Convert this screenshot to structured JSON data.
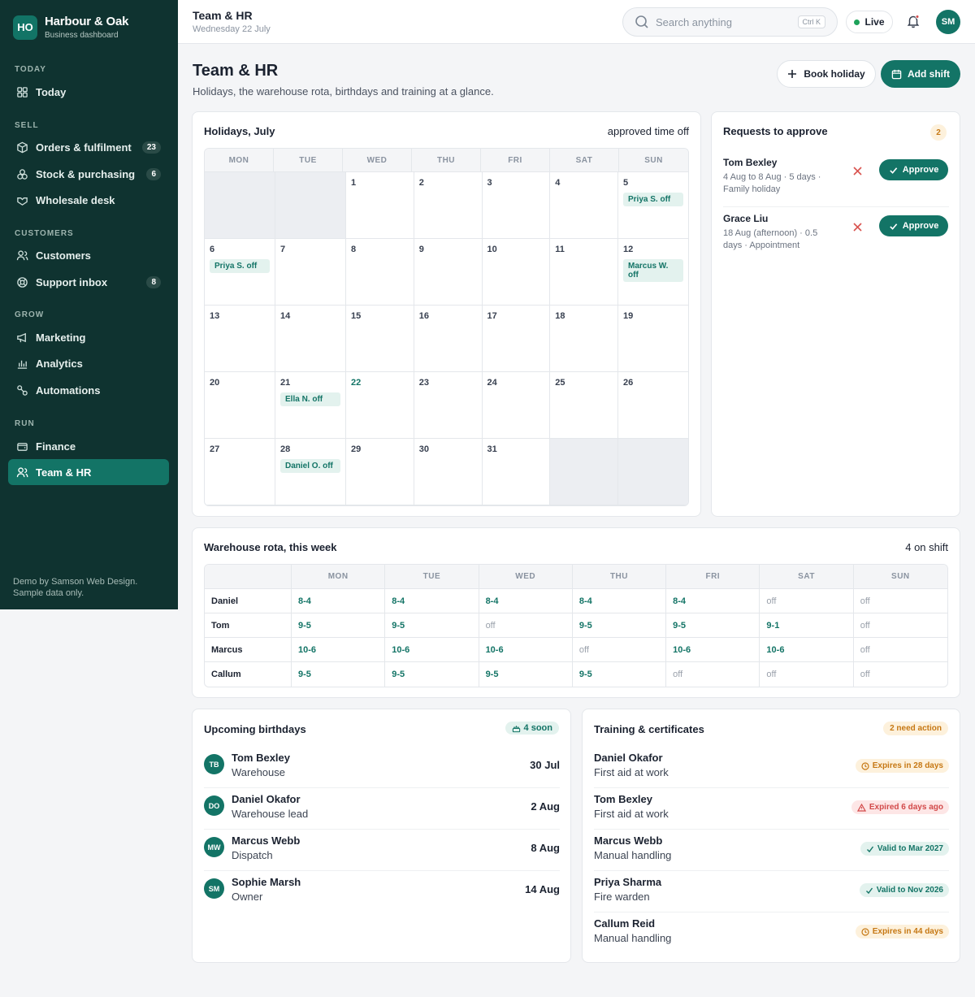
{
  "brand": {
    "initials": "HO",
    "name": "Harbour & Oak",
    "subtitle": "Business dashboard"
  },
  "sidebar": {
    "sections": [
      {
        "label": "TODAY"
      },
      {
        "label": "SELL"
      },
      {
        "label": "CUSTOMERS"
      },
      {
        "label": "GROW"
      },
      {
        "label": "RUN"
      }
    ],
    "items": [
      {
        "label": "Today",
        "icon": "grid-icon"
      },
      {
        "label": "Orders & fulfilment",
        "icon": "box-icon",
        "badge": "23"
      },
      {
        "label": "Stock & purchasing",
        "icon": "layers-icon",
        "badge": "6"
      },
      {
        "label": "Wholesale desk",
        "icon": "handshake-icon"
      },
      {
        "label": "Customers",
        "icon": "users-icon"
      },
      {
        "label": "Support inbox",
        "icon": "lifebuoy-icon",
        "badge": "8"
      },
      {
        "label": "Marketing",
        "icon": "megaphone-icon"
      },
      {
        "label": "Analytics",
        "icon": "bar-chart-icon"
      },
      {
        "label": "Automations",
        "icon": "workflow-icon"
      },
      {
        "label": "Finance",
        "icon": "wallet-icon"
      },
      {
        "label": "Team & HR",
        "icon": "user-group-icon",
        "active": true
      }
    ],
    "demo_line1": "Demo by Samson Web Design.",
    "demo_line2": "Sample data only."
  },
  "topbar": {
    "title": "Team & HR",
    "date": "Wednesday 22 July",
    "search_placeholder": "Search anything",
    "shortcut": "Ctrl K",
    "live_label": "Live",
    "avatar": "SM"
  },
  "header": {
    "title": "Team & HR",
    "subtitle": "Holidays, the warehouse rota, birthdays and training at a glance.",
    "book_holiday": "Book holiday",
    "add_shift": "Add shift"
  },
  "holidays": {
    "title": "Holidays, July",
    "meta": "approved time off",
    "weekdays": [
      "MON",
      "TUE",
      "WED",
      "THU",
      "FRI",
      "SAT",
      "SUN"
    ],
    "cells": [
      {
        "day": "",
        "empty": true
      },
      {
        "day": "",
        "empty": true
      },
      {
        "day": "1"
      },
      {
        "day": "2"
      },
      {
        "day": "3"
      },
      {
        "day": "4"
      },
      {
        "day": "5",
        "chip": "Priya S. off"
      },
      {
        "day": "6",
        "chip": "Priya S. off"
      },
      {
        "day": "7"
      },
      {
        "day": "8"
      },
      {
        "day": "9"
      },
      {
        "day": "10"
      },
      {
        "day": "11"
      },
      {
        "day": "12",
        "chip": "Marcus W. off"
      },
      {
        "day": "13"
      },
      {
        "day": "14"
      },
      {
        "day": "15"
      },
      {
        "day": "16"
      },
      {
        "day": "17"
      },
      {
        "day": "18"
      },
      {
        "day": "19"
      },
      {
        "day": "20"
      },
      {
        "day": "21",
        "chip": "Ella N. off"
      },
      {
        "day": "22",
        "today": true
      },
      {
        "day": "23"
      },
      {
        "day": "24"
      },
      {
        "day": "25"
      },
      {
        "day": "26"
      },
      {
        "day": "27"
      },
      {
        "day": "28",
        "chip": "Daniel O. off"
      },
      {
        "day": "29"
      },
      {
        "day": "30"
      },
      {
        "day": "31"
      },
      {
        "day": "",
        "empty": true
      },
      {
        "day": "",
        "empty": true
      }
    ]
  },
  "requests": {
    "title": "Requests to approve",
    "count": "2",
    "approve_label": "Approve",
    "items": [
      {
        "name": "Tom Bexley",
        "info": "4 Aug to 8 Aug · 5 days · Family holiday"
      },
      {
        "name": "Grace Liu",
        "info": "18 Aug (afternoon) · 0.5 days · Appointment"
      }
    ]
  },
  "rota": {
    "title": "Warehouse rota, this week",
    "meta": "4 on shift",
    "days": [
      "MON",
      "TUE",
      "WED",
      "THU",
      "FRI",
      "SAT",
      "SUN"
    ],
    "rows": [
      {
        "name": "Daniel",
        "shifts": [
          "8-4",
          "8-4",
          "8-4",
          "8-4",
          "8-4",
          "off",
          "off"
        ]
      },
      {
        "name": "Tom",
        "shifts": [
          "9-5",
          "9-5",
          "off",
          "9-5",
          "9-5",
          "9-1",
          "off"
        ]
      },
      {
        "name": "Marcus",
        "shifts": [
          "10-6",
          "10-6",
          "10-6",
          "off",
          "10-6",
          "10-6",
          "off"
        ]
      },
      {
        "name": "Callum",
        "shifts": [
          "9-5",
          "9-5",
          "9-5",
          "9-5",
          "off",
          "off",
          "off"
        ]
      }
    ]
  },
  "birthdays": {
    "title": "Upcoming birthdays",
    "badge": "4 soon",
    "items": [
      {
        "initials": "TB",
        "name": "Tom Bexley",
        "role": "Warehouse",
        "date": "30 Jul"
      },
      {
        "initials": "DO",
        "name": "Daniel Okafor",
        "role": "Warehouse lead",
        "date": "2 Aug"
      },
      {
        "initials": "MW",
        "name": "Marcus Webb",
        "role": "Dispatch",
        "date": "8 Aug"
      },
      {
        "initials": "SM",
        "name": "Sophie Marsh",
        "role": "Owner",
        "date": "14 Aug"
      }
    ]
  },
  "training": {
    "title": "Training & certificates",
    "badge": "2 need action",
    "items": [
      {
        "name": "Daniel Okafor",
        "course": "First aid at work",
        "status": "Expires in 28 days",
        "kind": "warn"
      },
      {
        "name": "Tom Bexley",
        "course": "First aid at work",
        "status": "Expired 6 days ago",
        "kind": "err"
      },
      {
        "name": "Marcus Webb",
        "course": "Manual handling",
        "status": "Valid to Mar 2027",
        "kind": "ok"
      },
      {
        "name": "Priya Sharma",
        "course": "Fire warden",
        "status": "Valid to Nov 2026",
        "kind": "ok"
      },
      {
        "name": "Callum Reid",
        "course": "Manual handling",
        "status": "Expires in 44 days",
        "kind": "warn"
      }
    ]
  },
  "colors": {
    "sidebar": "#0f3330",
    "accent": "#137466",
    "warning": "#c67814",
    "danger": "#d24a4a"
  }
}
